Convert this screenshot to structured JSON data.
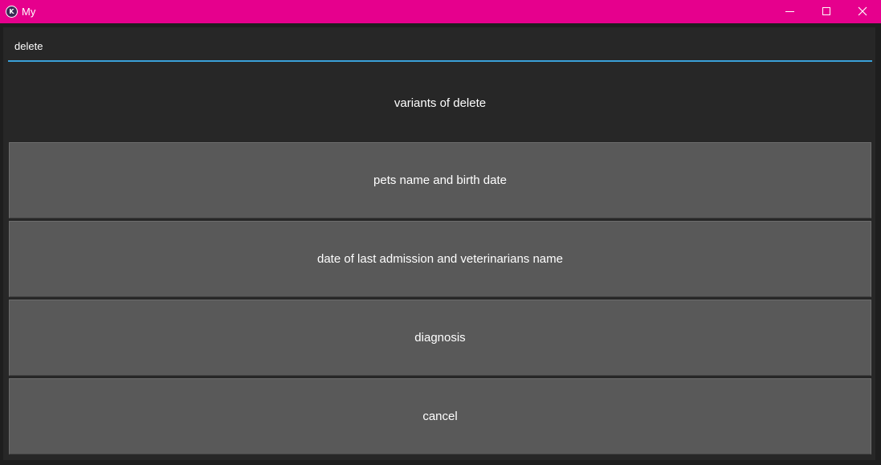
{
  "window": {
    "title": "My",
    "app_icon": "kivy-app-icon",
    "controls": [
      "minimize-icon",
      "maximize-icon",
      "close-icon"
    ],
    "titlebar_color": "#e6008d"
  },
  "search": {
    "value": "delete",
    "accent_color": "#3aa0d8"
  },
  "heading": "variants of delete",
  "options": [
    {
      "label": "pets name and birth date"
    },
    {
      "label": "date of last admission and veterinarians name"
    },
    {
      "label": "diagnosis"
    },
    {
      "label": "cancel"
    }
  ]
}
